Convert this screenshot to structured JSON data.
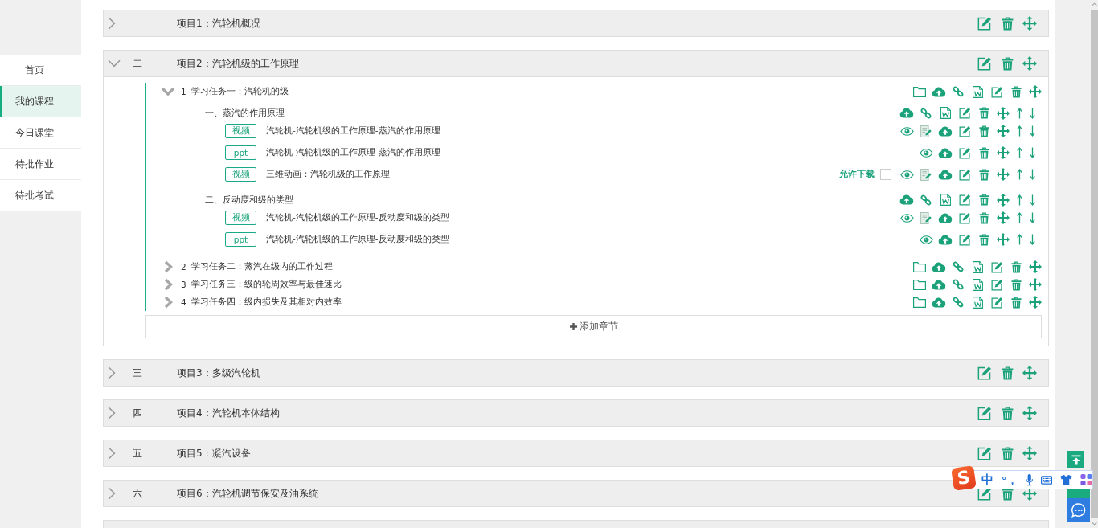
{
  "sidebar": {
    "items": [
      {
        "label": "首页",
        "selected": false
      },
      {
        "label": "我的课程",
        "selected": true
      },
      {
        "label": "今日课堂",
        "selected": false
      },
      {
        "label": "待批作业",
        "selected": false
      },
      {
        "label": "待批考试",
        "selected": false
      }
    ]
  },
  "projects": [
    {
      "numeral": "一",
      "title": "项目1：汽轮机概况",
      "expanded": false
    },
    {
      "numeral": "二",
      "title": "项目2：汽轮机级的工作原理",
      "expanded": true,
      "tasks": [
        {
          "number": "1",
          "title": "学习任务一：汽轮机的级",
          "expanded": true,
          "sections": [
            {
              "title": "一、蒸汽的作用原理",
              "resources": [
                {
                  "kind": "video",
                  "tag": "视频",
                  "title": "汽轮机-汽轮机级的工作原理-蒸汽的作用原理"
                },
                {
                  "kind": "ppt",
                  "tag": "ppt",
                  "title": "汽轮机-汽轮机级的工作原理-蒸汽的作用原理"
                },
                {
                  "kind": "video",
                  "tag": "视频",
                  "title": "三维动画：汽轮机级的工作原理",
                  "allow_download": {
                    "label": "允许下载",
                    "checked": false
                  }
                }
              ]
            },
            {
              "title": "二、反动度和级的类型",
              "resources": [
                {
                  "kind": "video",
                  "tag": "视频",
                  "title": "汽轮机-汽轮机级的工作原理-反动度和级的类型"
                },
                {
                  "kind": "ppt",
                  "tag": "ppt",
                  "title": "汽轮机-汽轮机级的工作原理-反动度和级的类型"
                }
              ]
            }
          ]
        },
        {
          "number": "2",
          "title": "学习任务二：蒸汽在级内的工作过程",
          "expanded": false
        },
        {
          "number": "3",
          "title": "学习任务三：级的轮周效率与最佳速比",
          "expanded": false
        },
        {
          "number": "4",
          "title": "学习任务四：级内损失及其相对内效率",
          "expanded": false
        }
      ],
      "add_button": "添加章节"
    },
    {
      "numeral": "三",
      "title": "项目3：多级汽轮机",
      "expanded": false
    },
    {
      "numeral": "四",
      "title": "项目4：汽轮机本体结构",
      "expanded": false
    },
    {
      "numeral": "五",
      "title": "项目5：凝汽设备",
      "expanded": false
    },
    {
      "numeral": "六",
      "title": "项目6：汽轮机调节保安及油系统",
      "expanded": false
    }
  ],
  "input_method_bar": {
    "logo": "S",
    "mode": "中",
    "punctuation": "°，"
  }
}
